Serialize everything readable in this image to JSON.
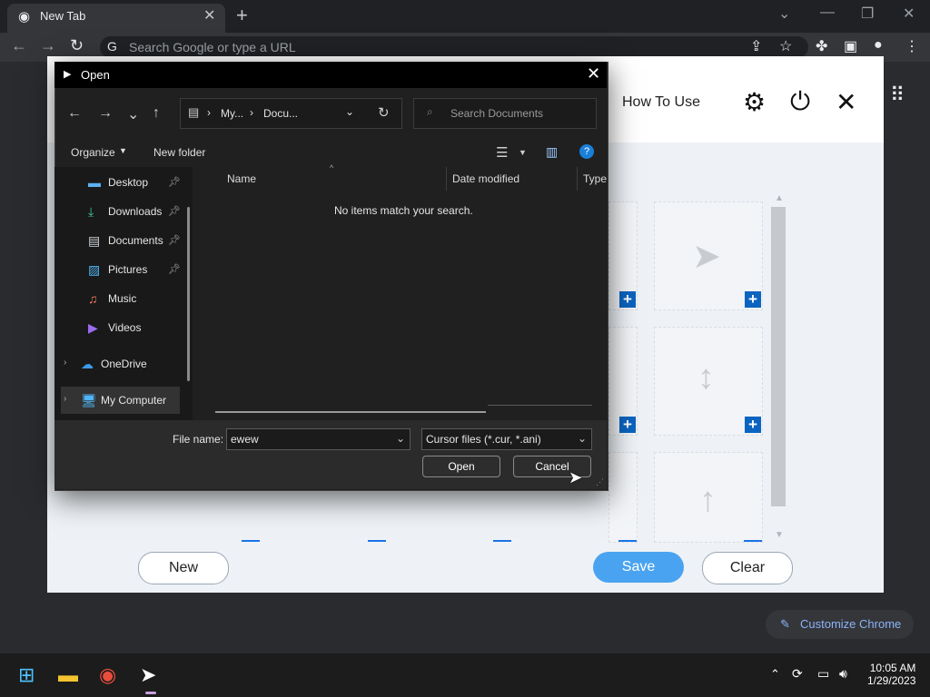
{
  "browser": {
    "tab_title": "New Tab",
    "omnibox_placeholder": "Search Google or type a URL"
  },
  "page": {
    "how_to_use": "How To Use",
    "buttons": {
      "new": "New",
      "save": "Save",
      "clear": "Clear"
    },
    "customize": "Customize Chrome"
  },
  "dialog": {
    "title": "Open",
    "breadcrumb": [
      "My...",
      "Docu..."
    ],
    "search_placeholder": "Search Documents",
    "organize": "Organize",
    "new_folder": "New folder",
    "sidebar": [
      {
        "label": "Desktop",
        "pinned": true
      },
      {
        "label": "Downloads",
        "pinned": true
      },
      {
        "label": "Documents",
        "pinned": true
      },
      {
        "label": "Pictures",
        "pinned": true
      },
      {
        "label": "Music"
      },
      {
        "label": "Videos"
      },
      {
        "label": "OneDrive"
      },
      {
        "label": "My Computer"
      }
    ],
    "columns": [
      "Name",
      "Date modified",
      "Type"
    ],
    "empty_message": "No items match your search.",
    "file_name_label": "File name:",
    "file_name_value": "ewew",
    "file_type": "Cursor files (*.cur, *.ani)",
    "open_button": "Open",
    "cancel_button": "Cancel"
  },
  "taskbar": {
    "time": "10:05 AM",
    "date": "1/29/2023"
  }
}
